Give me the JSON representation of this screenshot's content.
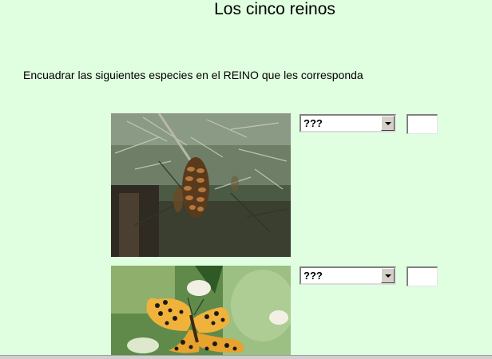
{
  "page": {
    "title": "Los cinco reinos",
    "instructions": "Encuadrar las siguientes especies en el REINO que les corresponda"
  },
  "species": [
    {
      "image_name": "pine-cone-photo",
      "kingdom_selected": "???",
      "answer_value": ""
    },
    {
      "image_name": "butterfly-photo",
      "kingdom_selected": "???",
      "answer_value": ""
    }
  ],
  "colors": {
    "page_background": "#e0ffe0"
  }
}
